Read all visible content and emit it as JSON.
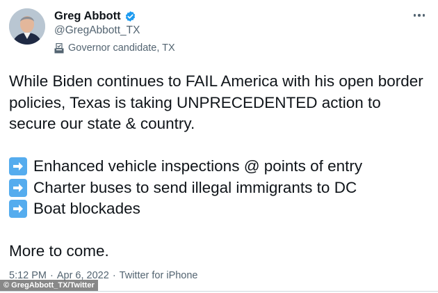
{
  "author": {
    "display_name": "Greg Abbott",
    "handle": "@GregAbbott_TX",
    "label": "Governor candidate, TX",
    "label_icon": "ballot-box-icon",
    "verified_icon": "verified-badge-icon"
  },
  "tweet": {
    "paragraph_1": "While Biden continues to FAIL America with his open border policies, Texas is taking UNPRECEDENTED action to secure our state & country.",
    "bullets": [
      "Enhanced vehicle inspections @ points of entry",
      "Charter buses to send illegal immigrants to DC",
      "Boat blockades"
    ],
    "bullet_icon": "right-arrow-emoji-icon",
    "closing": "More to come."
  },
  "meta": {
    "time": "5:12 PM",
    "separator": "·",
    "date": "Apr 6, 2022",
    "source": "Twitter for iPhone"
  },
  "credit": "© GregAbbott_TX/Twitter",
  "colors": {
    "verified": "#1d9bf0",
    "arrow_emoji": "#55acee",
    "secondary_text": "#536471",
    "primary_text": "#0f1419"
  }
}
